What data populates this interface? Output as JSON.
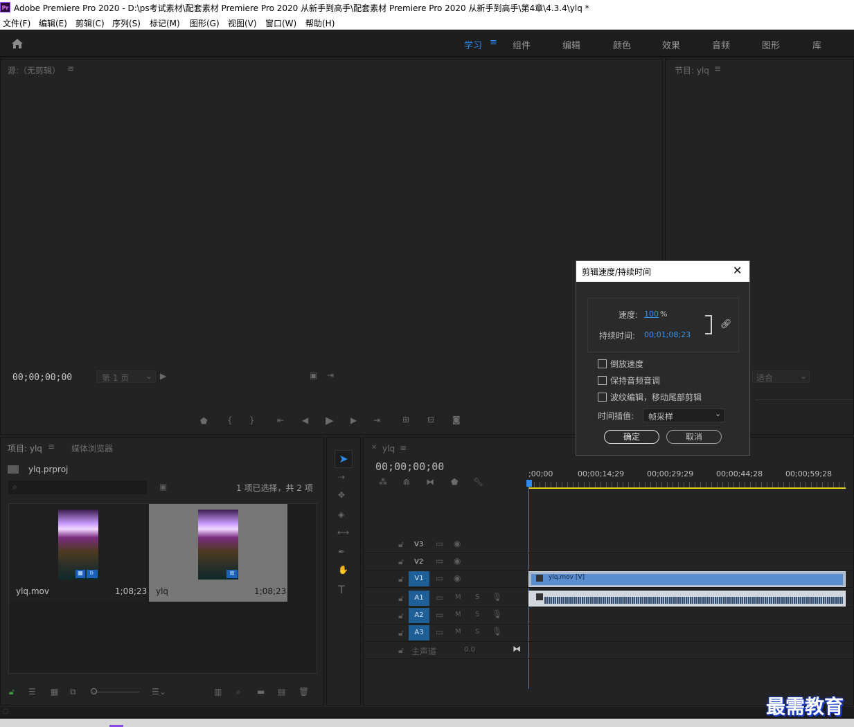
{
  "window": {
    "title": "Adobe Premiere Pro 2020 - D:\\ps考试素材\\配套素材 Premiere Pro 2020 从新手到高手\\配套素材 Premiere Pro 2020 从新手到高手\\第4章\\4.3.4\\ylq *",
    "logo": "Pr"
  },
  "menu": [
    "文件(F)",
    "编辑(E)",
    "剪辑(C)",
    "序列(S)",
    "标记(M)",
    "图形(G)",
    "视图(V)",
    "窗口(W)",
    "帮助(H)"
  ],
  "workspaces": {
    "home_icon": "home-icon",
    "tabs": [
      "学习",
      "组件",
      "编辑",
      "颜色",
      "效果",
      "音频",
      "图形",
      "库"
    ],
    "active": "学习"
  },
  "source_monitor": {
    "title": "源:（无剪辑）",
    "timecode": "00;00;00;00",
    "page": "第 1 页"
  },
  "program_monitor": {
    "title": "节目: ylq",
    "zoom": "适合"
  },
  "project_panel": {
    "tab_project": "项目: ylq",
    "tab_media": "媒体浏览器",
    "file": "ylq.prproj",
    "selection": "1 项已选择，共 2 项",
    "items": [
      {
        "name": "ylq.mov",
        "duration": "1;08;23"
      },
      {
        "name": "ylq",
        "duration": "1;08;23"
      }
    ]
  },
  "timeline": {
    "sequence": "ylq",
    "timecode": "00;00;00;00",
    "ruler": [
      ";00;00",
      "00;00;14;29",
      "00;00;29;29",
      "00;00;44;28",
      "00;00;59;28"
    ],
    "video_tracks": [
      "V3",
      "V2",
      "V1"
    ],
    "audio_tracks": [
      "A1",
      "A2",
      "A3"
    ],
    "master": "主声道",
    "master_value": "0.0",
    "clip_label": "ylq.mov [V]",
    "mute": "M",
    "solo": "S"
  },
  "dialog": {
    "title": "剪辑速度/持续时间",
    "speed_label": "速度:",
    "speed_value": "100",
    "speed_unit": "%",
    "duration_label": "持续时间:",
    "duration_value": "00;01;08;23",
    "reverse": "倒放速度",
    "keep_pitch": "保持音频音调",
    "ripple": "波纹编辑，移动尾部剪辑",
    "interp_label": "时间插值:",
    "interp_value": "帧采样",
    "ok": "确定",
    "cancel": "取消"
  },
  "watermark": "最需教育"
}
